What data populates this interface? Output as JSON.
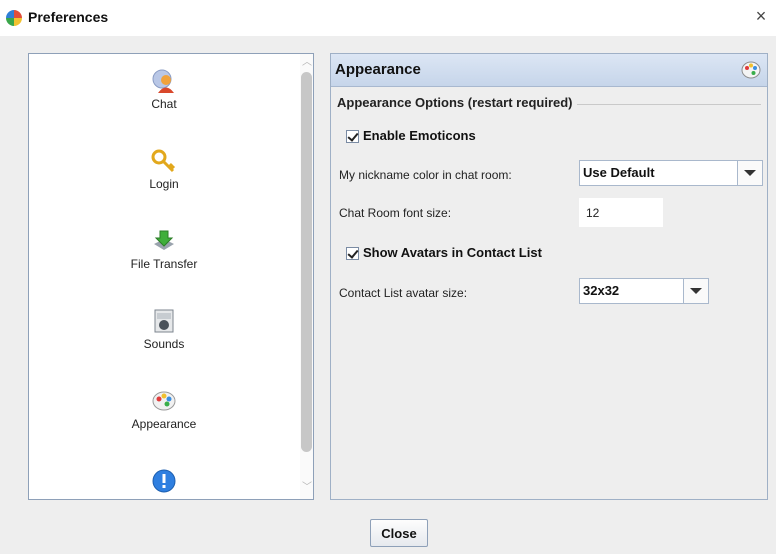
{
  "window": {
    "title": "Preferences",
    "close_glyph": "×"
  },
  "sidebar": {
    "items": [
      {
        "label": "Chat",
        "icon": "chat-user-icon"
      },
      {
        "label": "Login",
        "icon": "key-icon"
      },
      {
        "label": "File Transfer",
        "icon": "download-arrow-icon"
      },
      {
        "label": "Sounds",
        "icon": "speaker-icon"
      },
      {
        "label": "Appearance",
        "icon": "palette-icon"
      },
      {
        "label": "",
        "icon": "info-exclamation-icon"
      }
    ],
    "scroll_up_glyph": "︿",
    "scroll_down_glyph": "﹀"
  },
  "panel": {
    "title": "Appearance",
    "group_title": "Appearance Options (restart required)",
    "enable_emoticons": {
      "label": "Enable Emoticons",
      "checked": true
    },
    "nickname_color": {
      "label": "My nickname color in chat room:",
      "value": "Use Default"
    },
    "font_size": {
      "label": "Chat Room font size:",
      "value": "12"
    },
    "show_avatars": {
      "label": "Show Avatars in Contact List",
      "checked": true
    },
    "avatar_size": {
      "label": "Contact List avatar size:",
      "value": "32x32"
    }
  },
  "footer": {
    "close_label": "Close"
  },
  "colors": {
    "header_gradient_top": "#dce6f4",
    "header_gradient_bottom": "#c6d5ea",
    "border": "#8ea0b8"
  }
}
